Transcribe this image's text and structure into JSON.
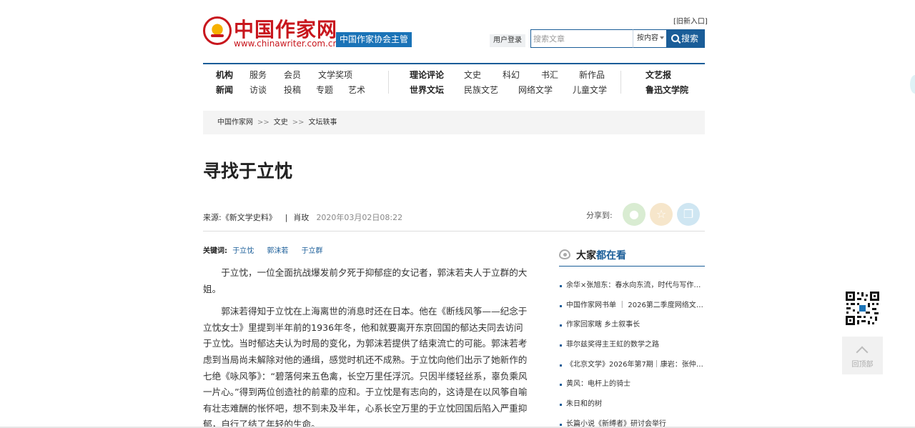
{
  "header": {
    "old_entry": "[旧新入口]",
    "logo_cn": "中国作家网",
    "logo_url": "www.chinawriter.com.cn",
    "org_badge": "中国作家协会主管",
    "login": "用户登录",
    "search": {
      "placeholder": "搜索文章",
      "scope": "按内容",
      "button": "搜索"
    }
  },
  "nav": {
    "group1_row1": [
      "机构",
      "服务",
      "会员",
      "文学奖项"
    ],
    "group1_row2": [
      "新闻",
      "访谈",
      "投稿",
      "专题",
      "艺术"
    ],
    "group2_row1": [
      "理论评论",
      "文史",
      "科幻",
      "书汇",
      "新作品"
    ],
    "group2_row2": [
      "世界文坛",
      "民族文艺",
      "网络文学",
      "儿童文学"
    ],
    "group3_row1": [
      "文艺报"
    ],
    "group3_row2": [
      "鲁迅文学院"
    ]
  },
  "breadcrumb": [
    "中国作家网",
    "文史",
    "文坛轶事"
  ],
  "breadcrumb_sep": ">>",
  "article": {
    "title": "寻找于立忱",
    "source_label": "来源:",
    "source": "《新文学史料》",
    "separator": "|",
    "author": "肖玫",
    "time": "2020年03月02日08:22",
    "share_label": "分享到:",
    "keywords_label": "关键词:",
    "keywords": [
      "于立忱",
      "郭沫若",
      "于立群"
    ],
    "paragraphs": [
      "于立忱，一位全面抗战爆发前夕死于抑郁症的女记者，郭沫若夫人于立群的大姐。",
      "郭沫若得知于立忱在上海离世的消息时还在日本。他在《断线风筝——纪念于立忱女士》里提到半年前的1936年冬，他和就要离开东京回国的郁达夫同去访问于立忱。当时郁达夫认为时局的变化，为郭沫若提供了结束流亡的可能。郭沫若考虑到当局尚未解除对他的通缉，感觉时机还不成熟。于立忱向他们出示了她新作的七绝《咏风筝》：“碧落何来五色禽，长空万里任浮沉。只因半缕轻丝系，辜负乘风一片心。”得到两位创造社的前辈的应和。于立忱是有志向的，这诗是在以风筝自喻有壮志难酬的怅怀吧，想不到未及半年，心系长空万里的于立忱回国后陷入严重抑郁，自行了结了年轻的生命。"
    ]
  },
  "sidebar": {
    "title_a": "大家",
    "title_b": "都在看",
    "items": [
      "余华×张旭东：春水向东流，时代与写作……",
      "中国作家网书单 ｜ 2026第二季度网络文……",
      "作家回家瞎 乡土叙事长",
      "菲尔兹奖得主王虹的数学之路",
      "《北京文学》2026年第7期｜康岩：张仲……",
      "黄风：电杆上的骑士",
      "朱日和的树",
      "长篇小说《新缚者》研讨会举行"
    ]
  },
  "floating": {
    "back_top": "回顶部"
  },
  "colors": {
    "brand_red": "#c8161d",
    "brand_blue": "#1a5d98",
    "badge_blue": "#1a73b7"
  },
  "icons": [
    "search-icon",
    "wechat-icon",
    "favorite-icon",
    "copy-icon",
    "eye-icon",
    "qr-code-icon",
    "arrow-up-icon"
  ]
}
